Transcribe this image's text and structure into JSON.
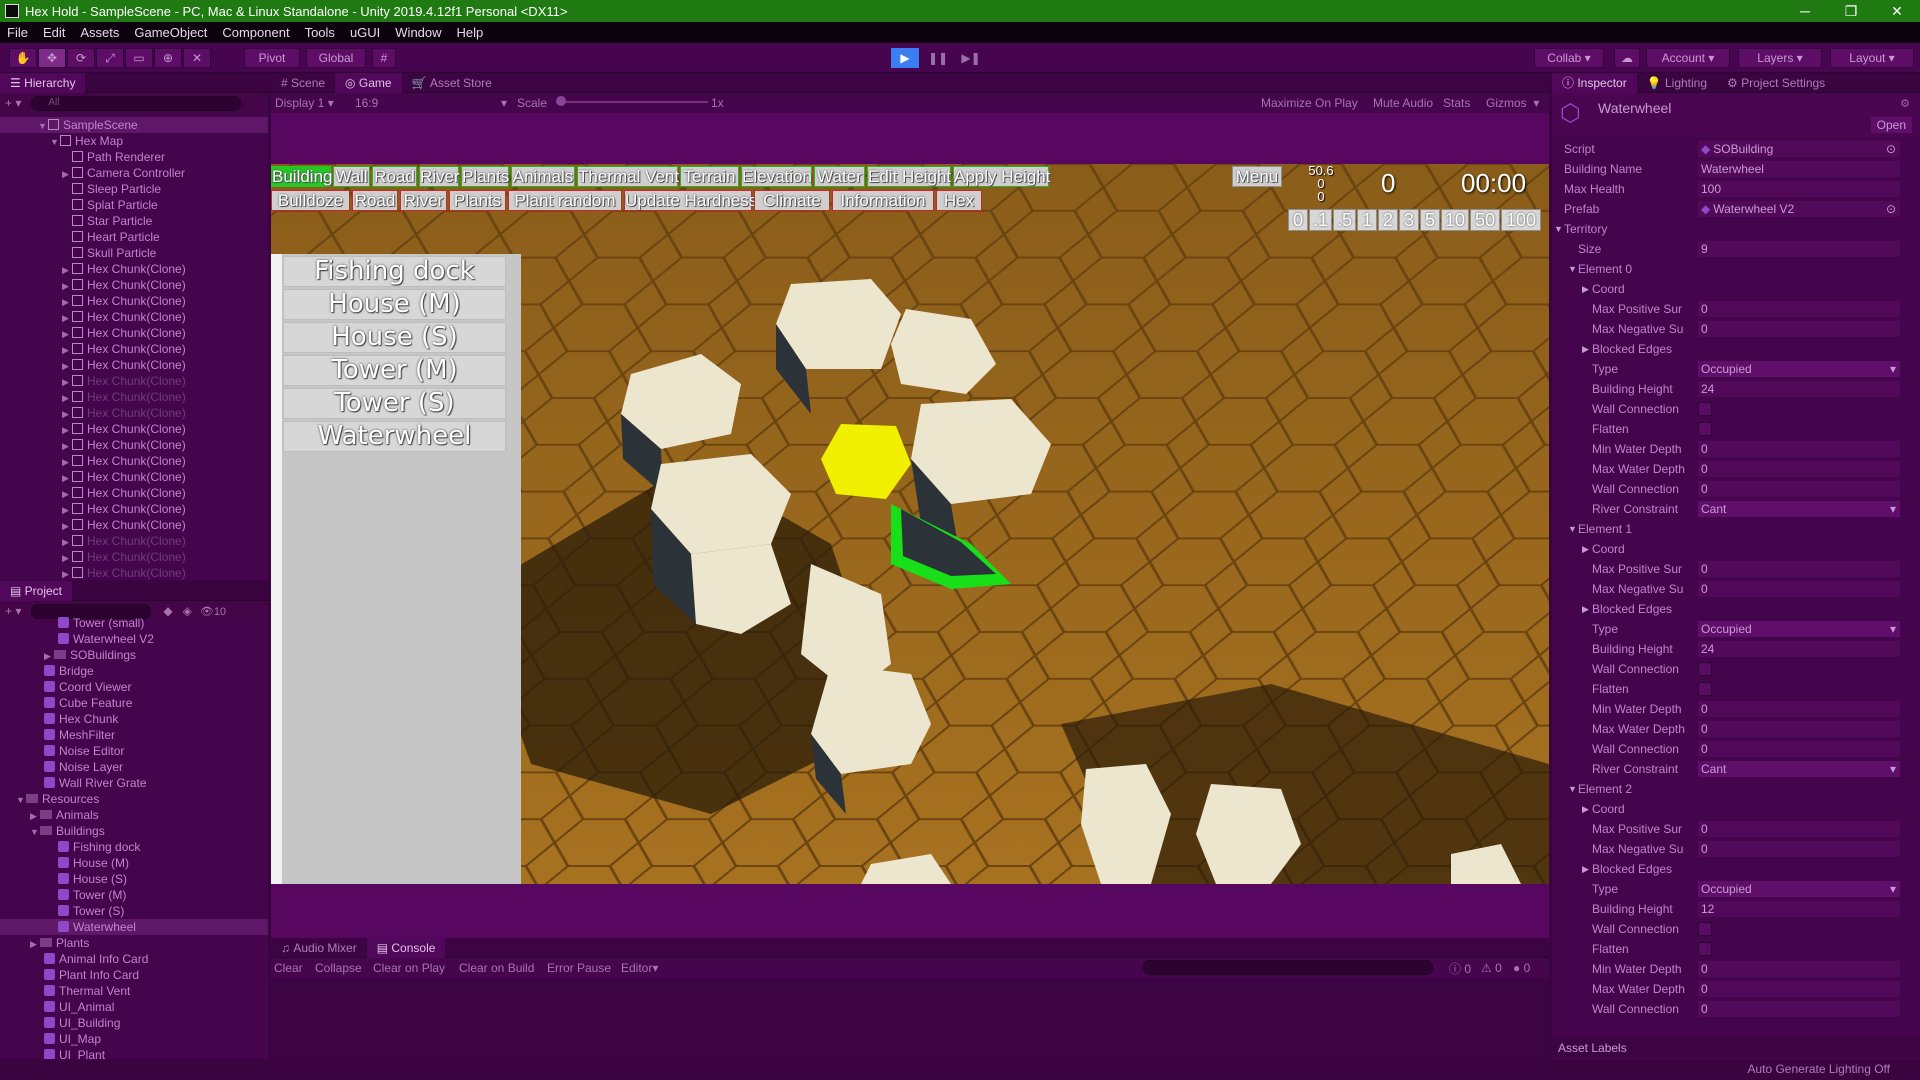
{
  "window": {
    "title": "Hex Hold - SampleScene - PC, Mac & Linux Standalone - Unity 2019.4.12f1 Personal <DX11>",
    "min": "─",
    "max": "❐",
    "close": "✕"
  },
  "menu": [
    "File",
    "Edit",
    "Assets",
    "GameObject",
    "Component",
    "Tools",
    "uGUI",
    "Window",
    "Help"
  ],
  "toolbar": {
    "pivot": "Pivot",
    "global": "Global",
    "collab": "Collab",
    "account": "Account",
    "layers": "Layers",
    "layout": "Layout"
  },
  "hierarchy": {
    "tab": "Hierarchy",
    "search": "All",
    "scene": "SampleScene",
    "root": "Hex Map",
    "children": [
      "Path Renderer",
      "Camera Controller",
      "Sleep Particle",
      "Splat Particle",
      "Star Particle",
      "Heart Particle",
      "Skull Particle"
    ],
    "chunk": "Hex Chunk(Clone)"
  },
  "project": {
    "tab": "Project",
    "count": "10",
    "items": [
      {
        "t": "Tower (small)",
        "k": "p",
        "i": 4
      },
      {
        "t": "Waterwheel V2",
        "k": "p",
        "i": 4
      },
      {
        "t": "SOBuildings",
        "k": "f",
        "i": 3
      },
      {
        "t": "Bridge",
        "k": "p",
        "i": 3
      },
      {
        "t": "Coord Viewer",
        "k": "p",
        "i": 3
      },
      {
        "t": "Cube Feature",
        "k": "p",
        "i": 3
      },
      {
        "t": "Hex Chunk",
        "k": "p",
        "i": 3
      },
      {
        "t": "MeshFilter",
        "k": "p",
        "i": 3
      },
      {
        "t": "Noise Editor",
        "k": "p",
        "i": 3
      },
      {
        "t": "Noise Layer",
        "k": "p",
        "i": 3
      },
      {
        "t": "Wall River Grate",
        "k": "p",
        "i": 3
      },
      {
        "t": "Resources",
        "k": "fo",
        "i": 1
      },
      {
        "t": "Animals",
        "k": "f",
        "i": 2
      },
      {
        "t": "Buildings",
        "k": "fo",
        "i": 2
      },
      {
        "t": "Fishing dock",
        "k": "p",
        "i": 4
      },
      {
        "t": "House (M)",
        "k": "p",
        "i": 4
      },
      {
        "t": "House (S)",
        "k": "p",
        "i": 4
      },
      {
        "t": "Tower (M)",
        "k": "p",
        "i": 4
      },
      {
        "t": "Tower (S)",
        "k": "p",
        "i": 4
      },
      {
        "t": "Waterwheel",
        "k": "p",
        "i": 4
      },
      {
        "t": "Plants",
        "k": "f",
        "i": 2
      },
      {
        "t": "Animal Info Card",
        "k": "p",
        "i": 3
      },
      {
        "t": "Plant Info Card",
        "k": "p",
        "i": 3
      },
      {
        "t": "Thermal Vent",
        "k": "p",
        "i": 3
      },
      {
        "t": "UI_Animal",
        "k": "p",
        "i": 3
      },
      {
        "t": "UI_Building",
        "k": "p",
        "i": 3
      },
      {
        "t": "UI_Map",
        "k": "p",
        "i": 3
      },
      {
        "t": "UI_Plant",
        "k": "p",
        "i": 3
      }
    ]
  },
  "center_tabs": {
    "scene": "Scene",
    "game": "Game",
    "store": "Asset Store"
  },
  "game_toolbar": {
    "display": "Display 1",
    "aspect": "16:9",
    "scale": "Scale",
    "scale_val": "1x",
    "maximize": "Maximize On Play",
    "mute": "Mute Audio",
    "stats": "Stats",
    "gizmos": "Gizmos"
  },
  "game_ui": {
    "row1": [
      "Building",
      "Wall",
      "Road",
      "River",
      "Plants",
      "Animals",
      "Thermal Vent",
      "Terrain",
      "Elevation",
      "Water",
      "Edit Height",
      "Apply Height"
    ],
    "menu": "Menu",
    "row2": [
      "Bulldoze",
      "Road",
      "River",
      "Plants",
      "Plant random",
      "Update Hardness",
      "Climate",
      "Information",
      "Hex"
    ],
    "stats": [
      "50.6",
      "0",
      "0"
    ],
    "score": "0",
    "timer": "00:00",
    "speeds": [
      "0",
      ".1",
      ".5",
      "1",
      "2",
      "3",
      "5",
      "10",
      "50",
      "100"
    ],
    "buildings": [
      "Fishing dock",
      "House (M)",
      "House (S)",
      "Tower (M)",
      "Tower (S)",
      "Waterwheel"
    ]
  },
  "bottom": {
    "audio": "Audio Mixer",
    "console": "Console",
    "clear": "Clear",
    "collapse": "Collapse",
    "clear_on_play": "Clear on Play",
    "clear_on_build": "Clear on Build",
    "error_pause": "Error Pause",
    "editor": "Editor",
    "c0": "0",
    "c1": "0",
    "c2": "0"
  },
  "inspector": {
    "tabs": [
      "Inspector",
      "Lighting",
      "Project Settings"
    ],
    "name": "Waterwheel",
    "open": "Open",
    "script_label": "Script",
    "script": "SOBuilding",
    "building_name_label": "Building Name",
    "building_name": "Waterwheel",
    "max_health_label": "Max Health",
    "max_health": "100",
    "prefab_label": "Prefab",
    "prefab": "Waterwheel V2",
    "territory": "Territory",
    "size_label": "Size",
    "size": "9",
    "elements": [
      {
        "name": "Element 0",
        "height": "24"
      },
      {
        "name": "Element 1",
        "height": "24"
      },
      {
        "name": "Element 2",
        "height": "12"
      }
    ],
    "f": {
      "coord": "Coord",
      "maxpos": "Max Positive Sur",
      "maxneg": "Max Negative Su",
      "blocked": "Blocked Edges",
      "type": "Type",
      "occupied": "Occupied",
      "bh": "Building Height",
      "wc": "Wall Connection",
      "flatten": "Flatten",
      "minwd": "Min Water Depth",
      "maxwd": "Max Water Depth",
      "rc": "River Constraint",
      "cant": "Cant",
      "zero": "0"
    },
    "asset_labels": "Asset Labels"
  },
  "status": {
    "text": "Auto Generate Lighting Off"
  }
}
